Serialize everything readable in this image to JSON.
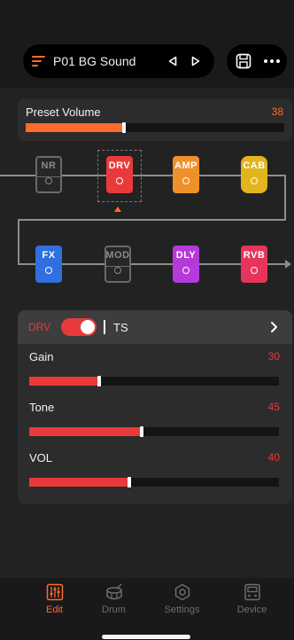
{
  "header": {
    "preset_label": "P01 BG Sound",
    "menu_icon": "menu-icon",
    "prev_icon": "triangle-left-icon",
    "next_icon": "triangle-right-icon",
    "save_icon": "save-icon",
    "more_icon": "more-dots-icon"
  },
  "preset_volume": {
    "label": "Preset Volume",
    "value": "38",
    "fill_fraction": 0.38,
    "color": "#ff6a2e"
  },
  "chain": {
    "row1": [
      {
        "label": "NR",
        "color": "#6a6a6a",
        "active": false
      },
      {
        "label": "DRV",
        "color": "#e83a3a",
        "active": true,
        "selected": true
      },
      {
        "label": "AMP",
        "color": "#f0902a",
        "active": true
      },
      {
        "label": "CAB",
        "color": "#e2b51c",
        "active": true
      }
    ],
    "row2": [
      {
        "label": "FX",
        "color": "#2f6fe0",
        "active": true
      },
      {
        "label": "MOD",
        "color": "#6a6a6a",
        "active": false
      },
      {
        "label": "DLY",
        "color": "#b63ad9",
        "active": true
      },
      {
        "label": "RVB",
        "color": "#e8345a",
        "active": true
      }
    ]
  },
  "editor": {
    "module_tag": "DRV",
    "enabled": true,
    "model": "TS",
    "accent": "#e83a3a",
    "params": [
      {
        "label": "Gain",
        "value": "30",
        "fraction": 0.28
      },
      {
        "label": "Tone",
        "value": "45",
        "fraction": 0.45
      },
      {
        "label": "VOL",
        "value": "40",
        "fraction": 0.4
      }
    ]
  },
  "tabs": [
    {
      "label": "Edit",
      "icon": "edit-sliders-icon",
      "active": true
    },
    {
      "label": "Drum",
      "icon": "drum-icon",
      "active": false
    },
    {
      "label": "Settings",
      "icon": "settings-gear-icon",
      "active": false
    },
    {
      "label": "Device",
      "icon": "device-icon",
      "active": false
    }
  ],
  "colors": {
    "active_tab": "#ff6a2e",
    "inactive_tab": "#6e6e6e"
  }
}
